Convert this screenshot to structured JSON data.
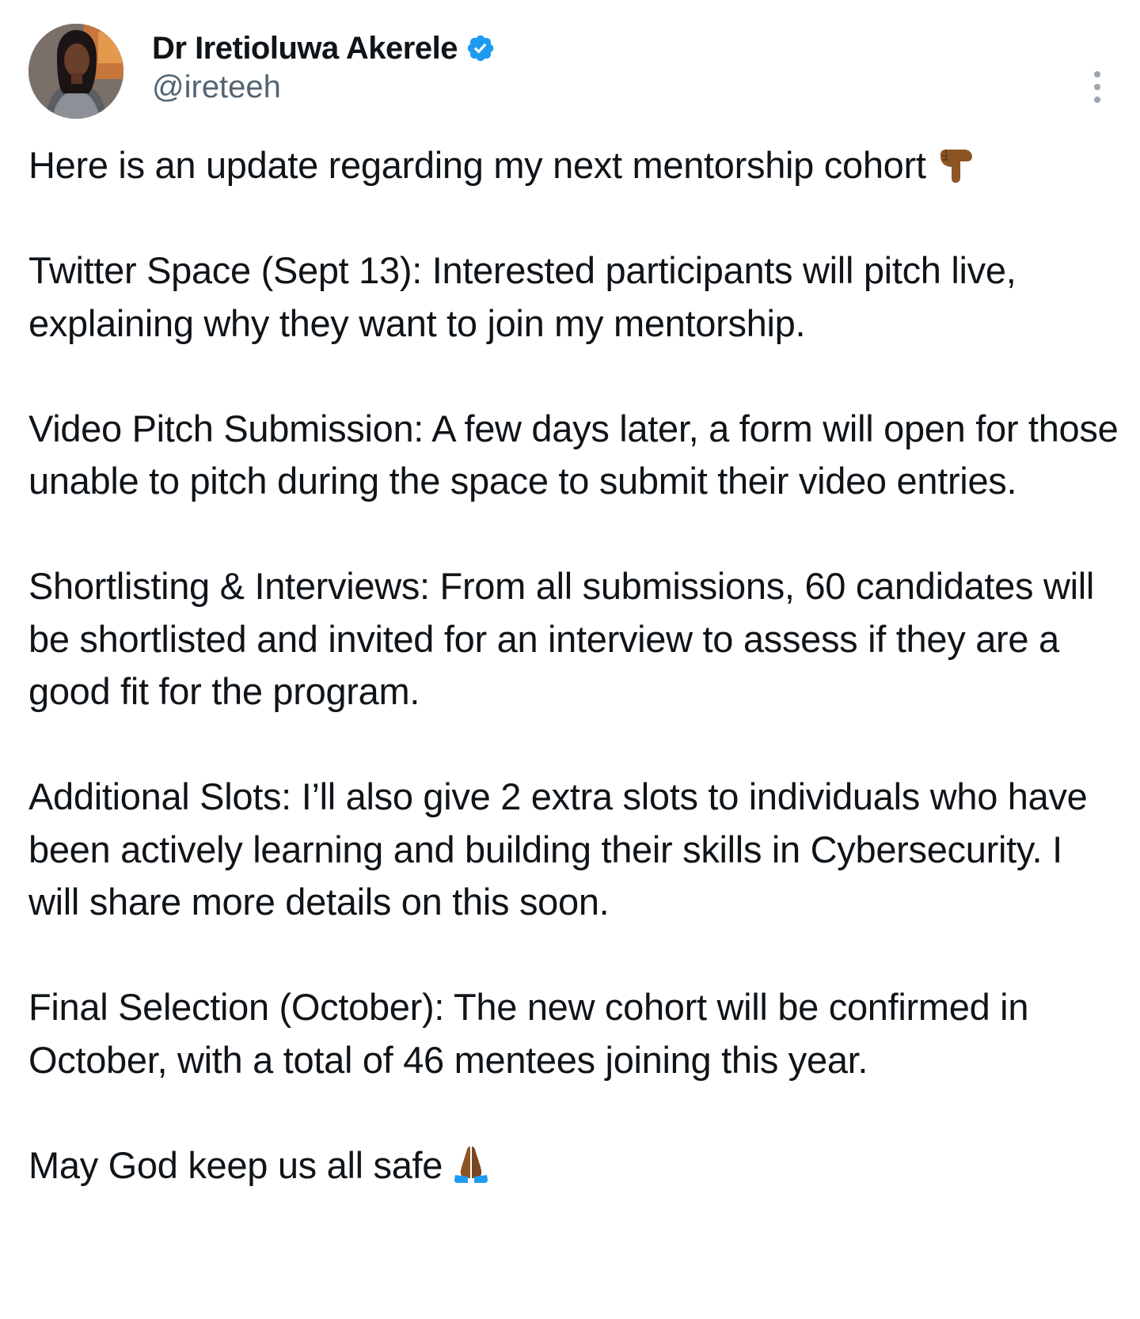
{
  "author": {
    "display_name": "Dr Iretioluwa Akerele",
    "handle": "@ireteeh",
    "verified": true,
    "verified_color": "#1d9bf0"
  },
  "icons": {
    "verified": "verified-badge-icon",
    "more": "more-options-icon",
    "emoji_intro": "backhand-index-pointing-down-icon",
    "emoji_closing": "folded-hands-icon"
  },
  "tweet": {
    "intro": "Here is an update regarding my next mentorship cohort",
    "twitter_space": "Twitter Space (Sept 13): Interested participants will pitch live, explaining why they want to join my mentorship.",
    "video_pitch": "Video Pitch Submission: A few days later, a form will open for those unable to pitch during the space to submit their video entries.",
    "shortlisting": "Shortlisting & Interviews: From all submissions, 60 candidates will be shortlisted and invited for an interview to assess if they are a good fit for the program.",
    "additional_slots": "Additional Slots: I’ll also give 2 extra slots to individuals who have been actively learning and building their skills in Cybersecurity. I will share more details on this soon.",
    "final_selection": "Final Selection (October): The new cohort will be confirmed in October, with a total of 46 mentees joining this year.",
    "closing": "May God keep us all safe"
  }
}
